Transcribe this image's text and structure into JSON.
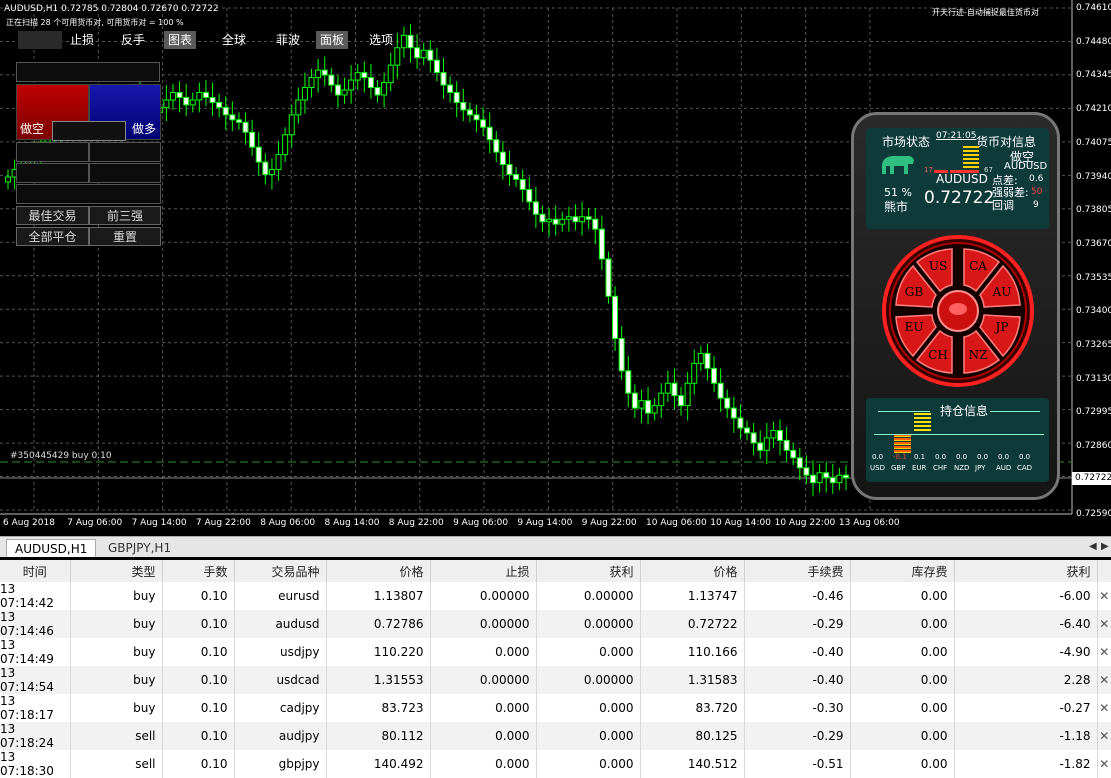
{
  "chart_header": {
    "symbol_info": "AUDUSD,H1  0.72785 0.72804 0.72670 0.72722",
    "scan_info": "正在扫描 28 个可用货币对, 可用货币对 = 100 %",
    "right_title": "开天行迹-自动捕捉最佳货币对"
  },
  "menu": [
    "止损",
    "反手",
    "图表",
    "全球",
    "菲波",
    "面板",
    "选项"
  ],
  "left_panel": {
    "sell_label": "做空",
    "buy_label": "做多",
    "best_trade": "最佳交易",
    "top_three": "前三强",
    "close_all": "全部平仓",
    "reset": "重置"
  },
  "y_axis_labels": [
    "0.74610",
    "0.74480",
    "0.74345",
    "0.74210",
    "0.74075",
    "0.73940",
    "0.73805",
    "0.73670",
    "0.73535",
    "0.73400",
    "0.73265",
    "0.73130",
    "0.72995",
    "0.72860",
    "0.72722",
    "0.72590"
  ],
  "current_price_label": "0.72722",
  "x_axis_labels": [
    "6 Aug 2018",
    "7 Aug 06:00",
    "7 Aug 14:00",
    "7 Aug 22:00",
    "8 Aug 06:00",
    "8 Aug 14:00",
    "8 Aug 22:00",
    "9 Aug 06:00",
    "9 Aug 14:00",
    "9 Aug 22:00",
    "10 Aug 06:00",
    "10 Aug 14:00",
    "10 Aug 22:00",
    "13 Aug 06:00"
  ],
  "order_line_label": "#350445429 buy 0.10",
  "widget": {
    "market_status": "市场状态",
    "time": "07:21:05",
    "pair_info": "货币对信息",
    "bear_pct": "51 %",
    "bear_label": "熊市",
    "pair": "AUDUSD",
    "price": "0.72722",
    "gauge_left": "17",
    "gauge_right": "67",
    "direction": "做空",
    "pair_small": "AUDUSD",
    "spread_label": "点差:",
    "spread_value": "0.6",
    "strength_label": "强弱差:",
    "strength_value": "50",
    "pullback_label": "回调",
    "pullback_value": "9",
    "currencies": [
      "US",
      "CA",
      "GB",
      "AU",
      "EU",
      "JP",
      "CH",
      "NZ"
    ],
    "position_title": "持仓信息",
    "position_values": [
      "0.0",
      "-0.1",
      "0.1",
      "0.0",
      "0.0",
      "0.0",
      "0.0",
      "0.0"
    ],
    "position_ccys": [
      "USD",
      "GBP",
      "EUR",
      "CHF",
      "NZD",
      "JPY",
      "AUD",
      "CAD"
    ]
  },
  "tabs": [
    "AUDUSD,H1",
    "GBPJPY,H1"
  ],
  "table": {
    "headers": [
      "时间",
      "类型",
      "手数",
      "交易品种",
      "价格",
      "止损",
      "获利",
      "价格",
      "手续费",
      "库存费",
      "获利"
    ],
    "rows": [
      [
        "13 07:14:42",
        "buy",
        "0.10",
        "eurusd",
        "1.13807",
        "0.00000",
        "0.00000",
        "1.13747",
        "-0.46",
        "0.00",
        "-6.00"
      ],
      [
        "13 07:14:46",
        "buy",
        "0.10",
        "audusd",
        "0.72786",
        "0.00000",
        "0.00000",
        "0.72722",
        "-0.29",
        "0.00",
        "-6.40"
      ],
      [
        "13 07:14:49",
        "buy",
        "0.10",
        "usdjpy",
        "110.220",
        "0.000",
        "0.000",
        "110.166",
        "-0.40",
        "0.00",
        "-4.90"
      ],
      [
        "13 07:14:54",
        "buy",
        "0.10",
        "usdcad",
        "1.31553",
        "0.00000",
        "0.00000",
        "1.31583",
        "-0.40",
        "0.00",
        "2.28"
      ],
      [
        "13 07:18:17",
        "buy",
        "0.10",
        "cadjpy",
        "83.723",
        "0.000",
        "0.000",
        "83.720",
        "-0.30",
        "0.00",
        "-0.27"
      ],
      [
        "13 07:18:24",
        "sell",
        "0.10",
        "audjpy",
        "80.112",
        "0.000",
        "0.000",
        "80.125",
        "-0.29",
        "0.00",
        "-1.18"
      ],
      [
        "13 07:18:30",
        "sell",
        "0.10",
        "gbpjpy",
        "140.492",
        "0.000",
        "0.000",
        "140.512",
        "-0.51",
        "0.00",
        "-1.82"
      ]
    ]
  },
  "chart_data": {
    "type": "candlestick",
    "symbol": "AUDUSD",
    "timeframe": "H1",
    "ylim": [
      0.7259,
      0.7461
    ],
    "closes": [
      0.7393,
      0.7396,
      0.7398,
      0.7401,
      0.7404,
      0.7407,
      0.741,
      0.7412,
      0.7415,
      0.7418,
      0.7419,
      0.7421,
      0.7422,
      0.742,
      0.7418,
      0.7416,
      0.7419,
      0.7421,
      0.7424,
      0.7426,
      0.7423,
      0.742,
      0.7419,
      0.7421,
      0.7424,
      0.7427,
      0.7425,
      0.7422,
      0.7424,
      0.7427,
      0.7425,
      0.7423,
      0.7421,
      0.7418,
      0.7416,
      0.7415,
      0.7411,
      0.7405,
      0.7399,
      0.7394,
      0.7396,
      0.7402,
      0.741,
      0.7418,
      0.7424,
      0.7429,
      0.7433,
      0.7436,
      0.7434,
      0.743,
      0.7426,
      0.7428,
      0.7432,
      0.7435,
      0.7433,
      0.7429,
      0.7426,
      0.7431,
      0.7438,
      0.7445,
      0.745,
      0.7445,
      0.7441,
      0.7444,
      0.744,
      0.7435,
      0.743,
      0.7427,
      0.7423,
      0.742,
      0.7418,
      0.7416,
      0.7413,
      0.7408,
      0.7403,
      0.7398,
      0.7394,
      0.7392,
      0.7388,
      0.7383,
      0.7378,
      0.7375,
      0.7376,
      0.7374,
      0.7376,
      0.7377,
      0.7375,
      0.7377,
      0.7376,
      0.7372,
      0.736,
      0.7345,
      0.7328,
      0.7315,
      0.7306,
      0.73,
      0.7303,
      0.7298,
      0.7301,
      0.7306,
      0.731,
      0.7305,
      0.7301,
      0.731,
      0.7318,
      0.7322,
      0.7316,
      0.731,
      0.7304,
      0.73,
      0.7296,
      0.7292,
      0.729,
      0.7286,
      0.7283,
      0.7288,
      0.7291,
      0.7287,
      0.7283,
      0.728,
      0.7276,
      0.7273,
      0.727,
      0.7274,
      0.7272,
      0.727,
      0.7273,
      0.7272
    ]
  }
}
